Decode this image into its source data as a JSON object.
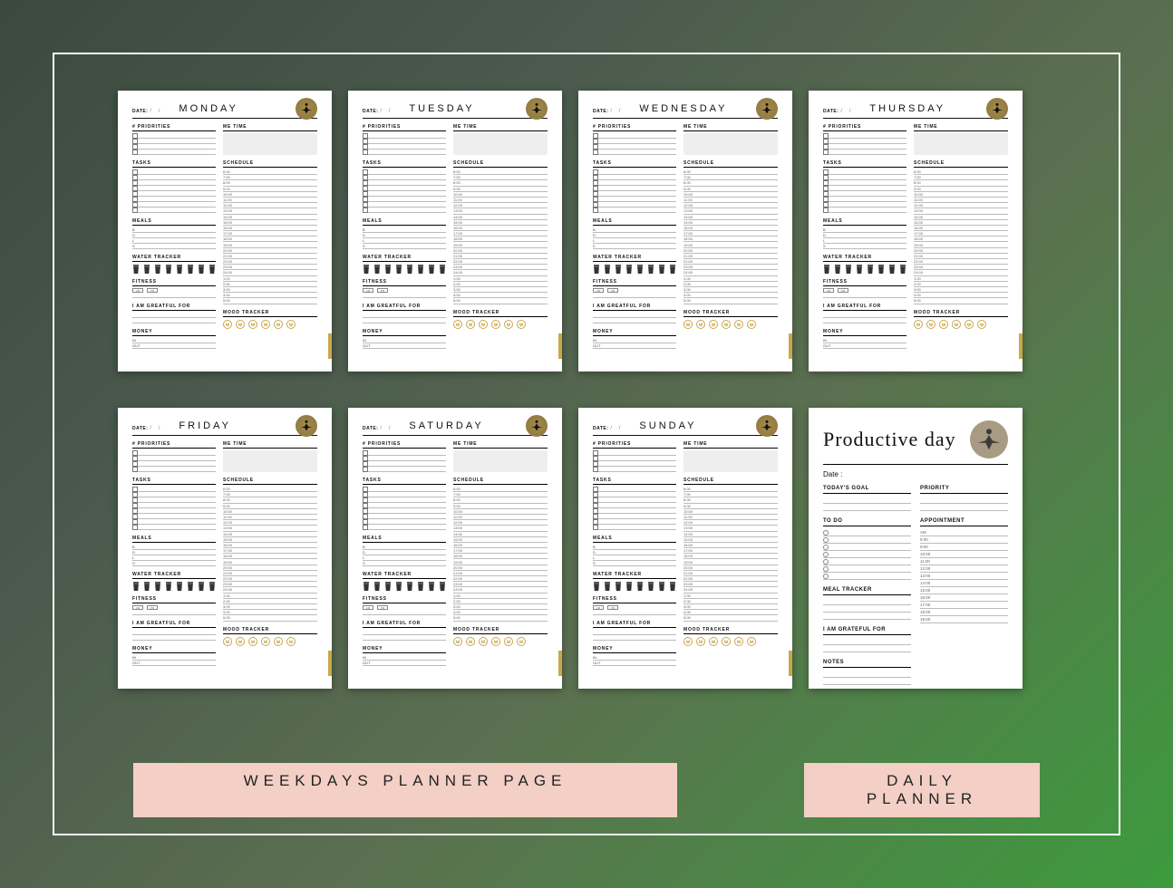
{
  "days": [
    "MONDAY",
    "TUESDAY",
    "WEDNESDAY",
    "THURSDAY",
    "FRIDAY",
    "SATURDAY",
    "SUNDAY"
  ],
  "page": {
    "date_label": "DATE:",
    "priorities_title": "# PRIORITIES",
    "me_time_title": "ME TIME",
    "tasks_title": "TASKS",
    "schedule_title": "SCHEDULE",
    "schedule_times": [
      "6:00",
      "7:00",
      "8:00",
      "9:00",
      "10:00",
      "11:00",
      "12:00",
      "13:00",
      "14:00",
      "15:00",
      "16:00",
      "17:00",
      "18:00",
      "19:00",
      "20:00",
      "21:00",
      "22:00",
      "23:00",
      "24:00",
      "1:00",
      "2:00",
      "3:00",
      "4:00",
      "5:00"
    ],
    "meals_title": "MEALS",
    "meals": [
      "B",
      "D",
      "L",
      "S"
    ],
    "water_title": "WATER TRACKER",
    "fitness_title": "FITNESS",
    "fitness_opts": [
      "AM",
      "PM"
    ],
    "grateful_title": "I AM GREATFUL FOR",
    "money_title": "MONEY",
    "money_rows": [
      "IN",
      "OUT"
    ],
    "mood_title": "MOOD TRACKER"
  },
  "daily": {
    "title": "Productive day",
    "date_label": "Date :",
    "goal_title": "TODAY'S GOAL",
    "priority_title": "PRIORITY",
    "todo_title": "TO DO",
    "appointment_title": "APPOINTMENT",
    "appointment_times": [
      "AM",
      "8:00",
      "9:00",
      "10:00",
      "11:00",
      "12:00",
      "13:00",
      "14:00",
      "15:00",
      "16:00",
      "17:00",
      "18:00",
      "19:00"
    ],
    "meal_title": "MEAL TRACKER",
    "grateful_title": "I AM GRATEFUL FOR",
    "notes_title": "NOTES"
  },
  "labels": {
    "weekdays": "WEEKDAYS  PLANNER  PAGE",
    "daily": "DAILY PLANNER"
  }
}
